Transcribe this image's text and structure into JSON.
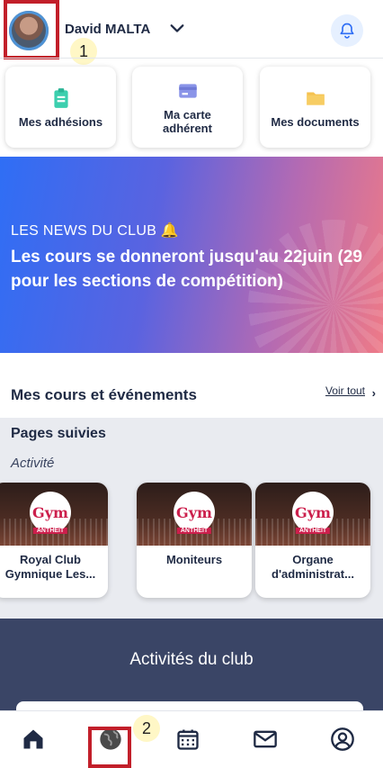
{
  "header": {
    "username": "David MALTA",
    "avatar_icon": "user-avatar",
    "chevron_icon": "chevron-down-icon",
    "bell_icon": "bell-icon"
  },
  "annotations": {
    "marker_1": "1",
    "marker_2": "2",
    "highlight_color": "#c21f2a"
  },
  "quick_actions": [
    {
      "label": "Mes adhésions",
      "icon": "clipboard-icon",
      "color": "#3ccfae"
    },
    {
      "label": "Ma carte adhérent",
      "icon": "card-icon",
      "color": "#8a94e8"
    },
    {
      "label": "Mes documents",
      "icon": "folder-icon",
      "color": "#f5c250"
    }
  ],
  "banner": {
    "kicker": "LES NEWS DU CLUB 🔔",
    "headline": "Les cours se donneront jusqu'au 22juin (29 pour les sections de compétition)"
  },
  "courses": {
    "title": "Mes cours et événements",
    "see_all": "Voir tout"
  },
  "followed_pages": {
    "title": "Pages suivies",
    "subtitle": "Activité",
    "logo_text": "Gym",
    "logo_tag": "ANTHEIT",
    "cards": [
      {
        "name": "Royal Club Gymnique Les..."
      },
      {
        "name": "Moniteurs"
      },
      {
        "name": "Organe d'administrat..."
      }
    ]
  },
  "activities": {
    "title": "Activités du club"
  },
  "bottom_nav": [
    {
      "icon": "home-icon"
    },
    {
      "icon": "globe-icon"
    },
    {
      "icon": "calendar-icon"
    },
    {
      "icon": "mail-icon"
    },
    {
      "icon": "profile-icon"
    }
  ],
  "colors": {
    "navy": "#1f2a44",
    "activities_bg": "#3a4566",
    "followed_bg": "#e9ebf0",
    "banner_start": "#2f6ef5",
    "banner_end": "#ee7a87"
  }
}
